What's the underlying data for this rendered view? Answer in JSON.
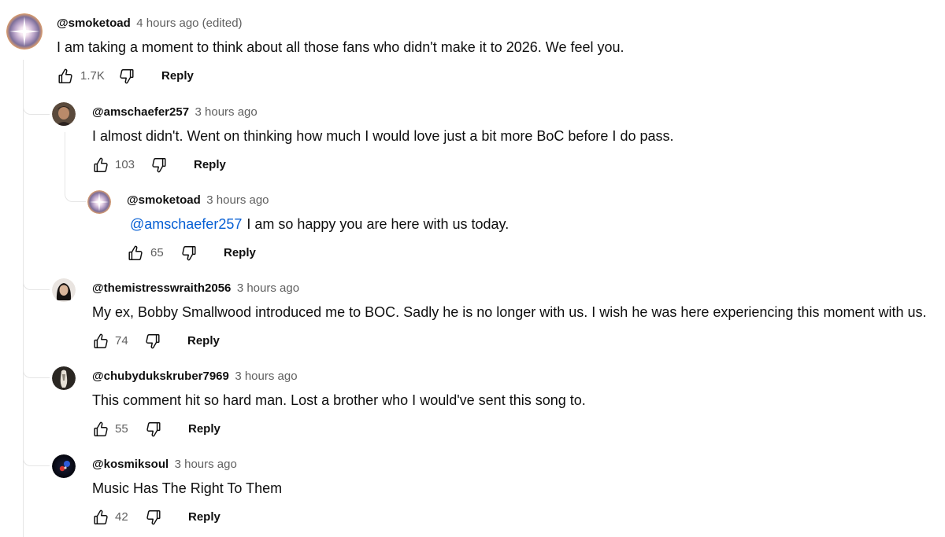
{
  "colors": {
    "mention": "#065fd4",
    "meta": "#606060",
    "text": "#0f0f0f",
    "thread_line": "#e5e5e5"
  },
  "comments": [
    {
      "author": "@smoketoad",
      "time": "4 hours ago (edited)",
      "text": "I am taking a moment to think about all those fans who didn't make it to 2026. We feel you.",
      "likes": "1.7K",
      "reply_label": "Reply",
      "avatar": "sparkle-avatar"
    },
    {
      "author": "@amschaefer257",
      "time": "3 hours ago",
      "text": "I almost didn't. Went on thinking how much I would love just a bit more BoC before I do pass.",
      "likes": "103",
      "reply_label": "Reply",
      "avatar": "portrait-avatar"
    },
    {
      "author": "@smoketoad",
      "time": "3 hours ago",
      "mention": "@amschaefer257",
      "text": "I am so happy you are here with us today.",
      "likes": "65",
      "reply_label": "Reply",
      "avatar": "sparkle-avatar"
    },
    {
      "author": "@themistresswraith2056",
      "time": "3 hours ago",
      "text": "My ex, Bobby Smallwood introduced me to BOC. Sadly he is no longer with us. I wish he was here experiencing this moment with us.",
      "likes": "74",
      "reply_label": "Reply",
      "avatar": "portrait-avatar"
    },
    {
      "author": "@chubydukskruber7969",
      "time": "3 hours ago",
      "text": "This comment hit so hard man. Lost a brother who I would've sent this song to.",
      "likes": "55",
      "reply_label": "Reply",
      "avatar": "figure-avatar"
    },
    {
      "author": "@kosmiksoul",
      "time": "3 hours ago",
      "text": "Music Has The Right To Them",
      "likes": "42",
      "reply_label": "Reply",
      "avatar": "dark-orb-avatar"
    }
  ]
}
